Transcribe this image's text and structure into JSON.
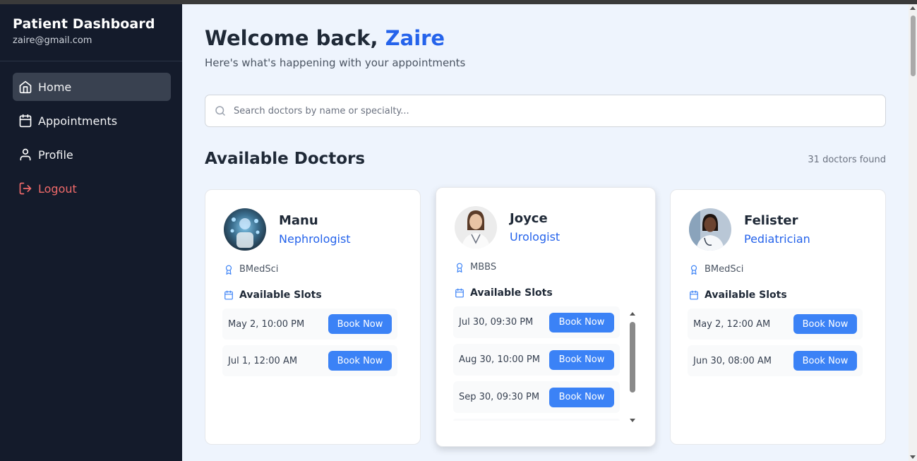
{
  "sidebar": {
    "title": "Patient Dashboard",
    "email": "zaire@gmail.com",
    "items": [
      {
        "label": "Home",
        "icon": "home-icon"
      },
      {
        "label": "Appointments",
        "icon": "calendar-icon"
      },
      {
        "label": "Profile",
        "icon": "user-icon"
      },
      {
        "label": "Logout",
        "icon": "logout-icon"
      }
    ]
  },
  "header": {
    "welcome": "Welcome back,",
    "name": "Zaire",
    "subtitle": "Here's what's happening with your appointments"
  },
  "search": {
    "placeholder": "Search doctors by name or specialty...",
    "value": ""
  },
  "doctors_section": {
    "title": "Available Doctors",
    "count": "31 doctors found",
    "slots_label": "Available Slots",
    "book_label": "Book Now"
  },
  "doctors": [
    {
      "name": "Manu",
      "specialty": "Nephrologist",
      "qualification": "BMedSci",
      "slots": [
        "May 2, 10:00 PM",
        "Jul 1, 12:00 AM"
      ]
    },
    {
      "name": "Joyce",
      "specialty": "Urologist",
      "qualification": "MBBS",
      "slots": [
        "Jul 30, 09:30 PM",
        "Aug 30, 10:00 PM",
        "Sep 30, 09:30 PM"
      ]
    },
    {
      "name": "Felister",
      "specialty": "Pediatrician",
      "qualification": "BMedSci",
      "slots": [
        "May 2, 12:00 AM",
        "Jun 30, 08:00 AM"
      ]
    }
  ],
  "colors": {
    "sidebar_bg": "#141b2b",
    "accent": "#2563eb",
    "button": "#3b82f6",
    "logout": "#f06a6a",
    "page_bg": "#eef4fd"
  }
}
